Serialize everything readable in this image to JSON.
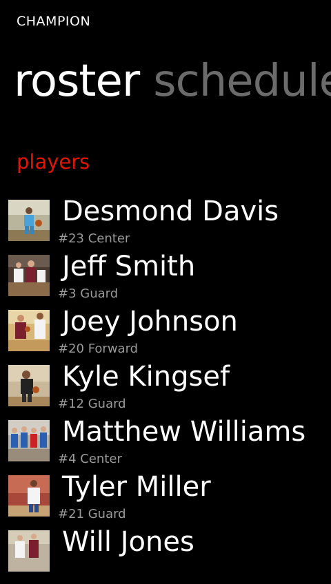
{
  "app": {
    "title": "CHAMPION"
  },
  "pivot": {
    "active_tab": "roster",
    "next_tab": "schedule"
  },
  "section": {
    "title": "players"
  },
  "players": [
    {
      "name": "Desmond Davis",
      "detail": "#23 Center"
    },
    {
      "name": "Jeff Smith",
      "detail": "#3 Guard"
    },
    {
      "name": "Joey Johnson",
      "detail": "#20 Forward"
    },
    {
      "name": "Kyle Kingsef",
      "detail": "#12 Guard"
    },
    {
      "name": "Matthew Williams",
      "detail": "#4 Center"
    },
    {
      "name": "Tyler Miller",
      "detail": "#21 Guard"
    },
    {
      "name": "Will Jones",
      "detail": ""
    }
  ],
  "colors": {
    "accent": "#e51400",
    "background": "#000000",
    "inactive_tab": "#6b6b6b",
    "subtext": "#9a9a9a"
  }
}
